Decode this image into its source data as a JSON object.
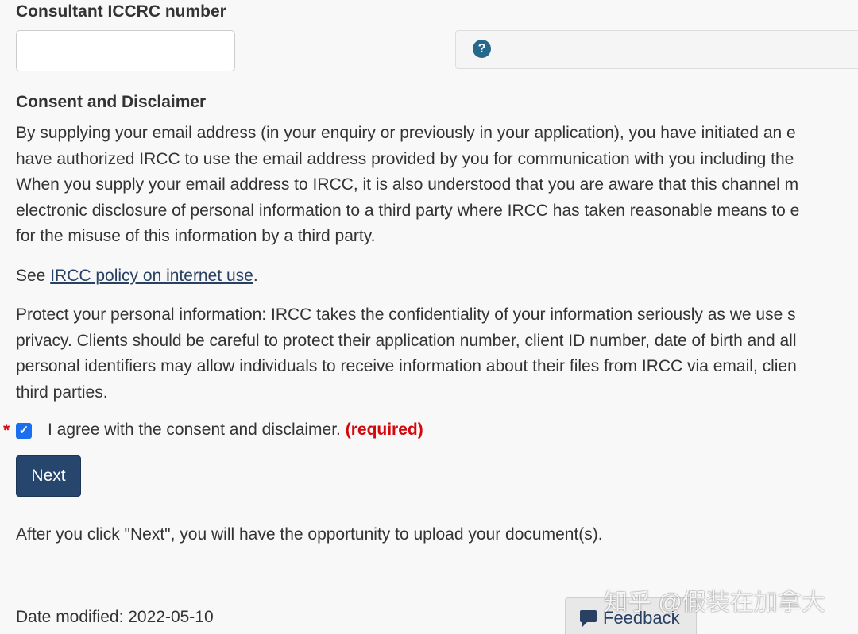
{
  "iccrc": {
    "label": "Consultant ICCRC number",
    "value": "",
    "help_icon": "question-circle-icon",
    "help_glyph": "?"
  },
  "consent": {
    "heading": "Consent and Disclaimer",
    "paragraph1": [
      "By supplying your email address (in your enquiry or previously in your application), you have initiated an e",
      "have authorized IRCC to use the email address provided by you for communication with you including the",
      "When you supply your email address to IRCC, it is also understood that you are aware that this channel m",
      "electronic disclosure of personal information to a third party where IRCC has taken reasonable means to e",
      "for the misuse of this information by a third party."
    ],
    "see_prefix": "See ",
    "policy_link": "IRCC policy on internet use",
    "see_suffix": ".",
    "paragraph3": [
      "Protect your personal information: IRCC takes the confidentiality of your information seriously as we use s",
      "privacy. Clients should be careful to protect their application number, client ID number, date of birth and all",
      "personal identifiers may allow individuals to receive information about their files from IRCC via email, clien",
      "third parties."
    ]
  },
  "agree": {
    "required_marker": "*",
    "checked": true,
    "check_glyph": "✓",
    "label": "I agree with the consent and disclaimer.",
    "required_text": "(required)"
  },
  "next_button_label": "Next",
  "after_text": "After you click \"Next\", you will have the opportunity to upload your document(s).",
  "date_modified": "Date modified: 2022-05-10",
  "feedback": {
    "label": "Feedback",
    "icon": "comment-icon"
  },
  "watermark": "知乎 @假装在加拿大",
  "colors": {
    "link": "#284162",
    "button": "#26466d",
    "required": "#d3080c",
    "help_icon": "#26688c",
    "checkbox": "#1a6ff0"
  }
}
